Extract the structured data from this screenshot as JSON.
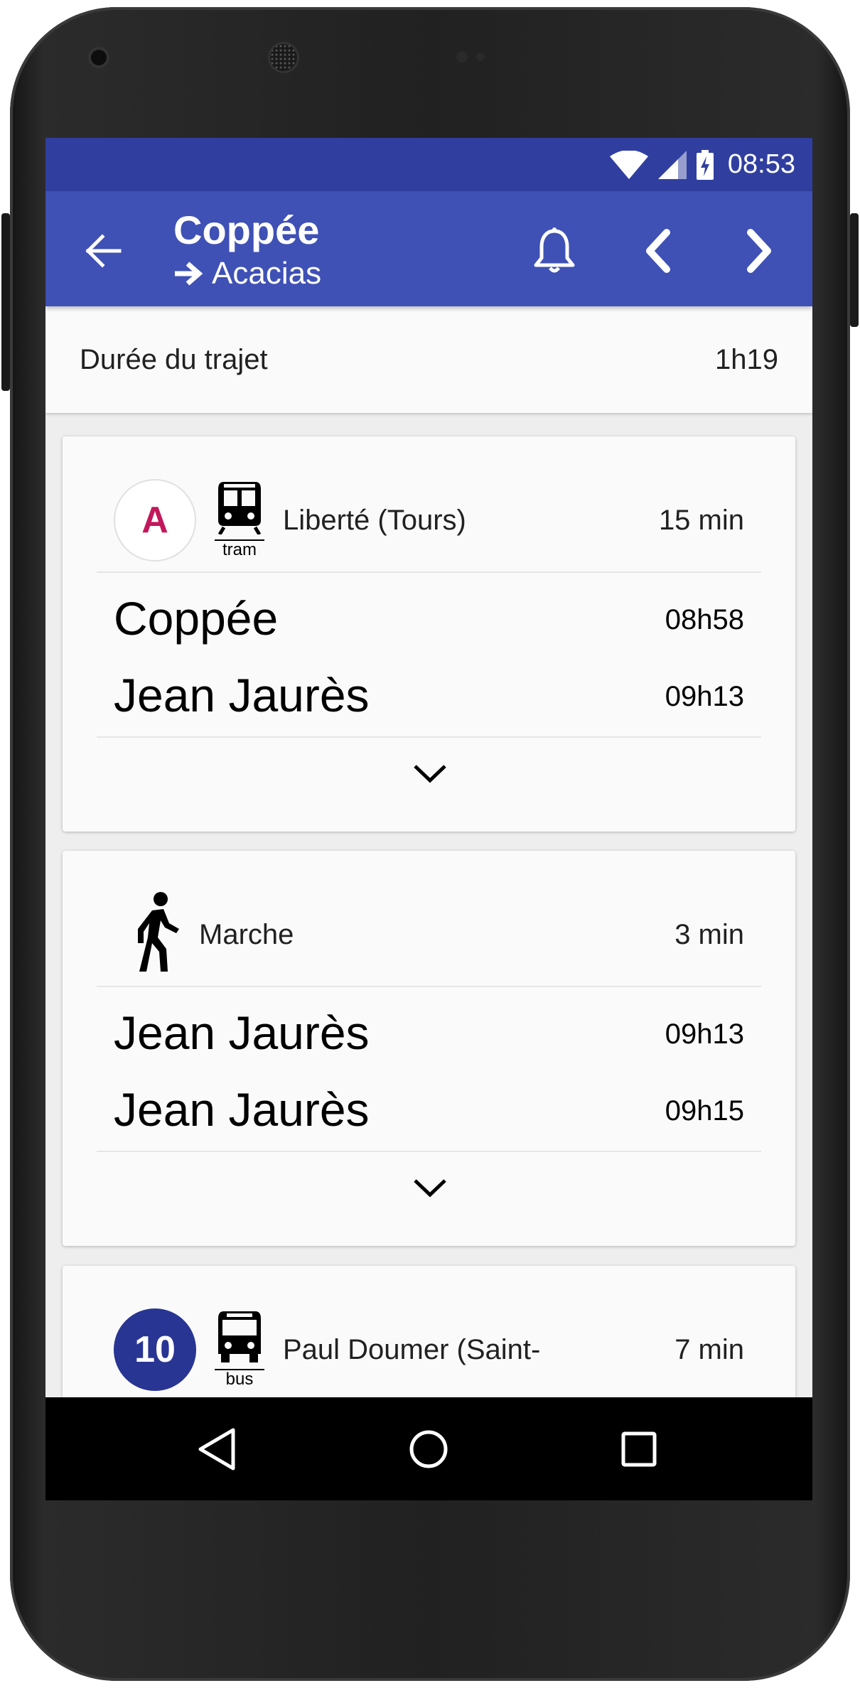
{
  "status_bar": {
    "time": "08:53",
    "icons": [
      "wifi-icon",
      "cell-signal-icon",
      "battery-charging-icon"
    ]
  },
  "app_bar": {
    "title": "Coppée",
    "subtitle": "Acacias",
    "icons": [
      "arrow-back-icon",
      "arrow-right-icon",
      "bell-icon",
      "chevron-left-icon",
      "chevron-right-icon"
    ]
  },
  "summary": {
    "label": "Durée du trajet",
    "value": "1h19"
  },
  "legs": [
    {
      "line": "A",
      "mode": "tram",
      "direction": "Liberté (Tours)",
      "duration": "15 min",
      "from": {
        "stop": "Coppée",
        "time": "08h58"
      },
      "to": {
        "stop": "Jean Jaurès",
        "time": "09h13"
      }
    },
    {
      "mode_label": "Marche",
      "duration": "3 min",
      "from": {
        "stop": "Jean Jaurès",
        "time": "09h13"
      },
      "to": {
        "stop": "Jean Jaurès",
        "time": "09h15"
      }
    },
    {
      "line": "10",
      "mode": "bus",
      "direction": "Paul Doumer (Saint-",
      "duration": "7 min"
    }
  ],
  "colors": {
    "primary": "#3f51b5",
    "primary_dark": "#303f9f",
    "line_a_text": "#c2185b",
    "line_10_bg": "#283593"
  }
}
